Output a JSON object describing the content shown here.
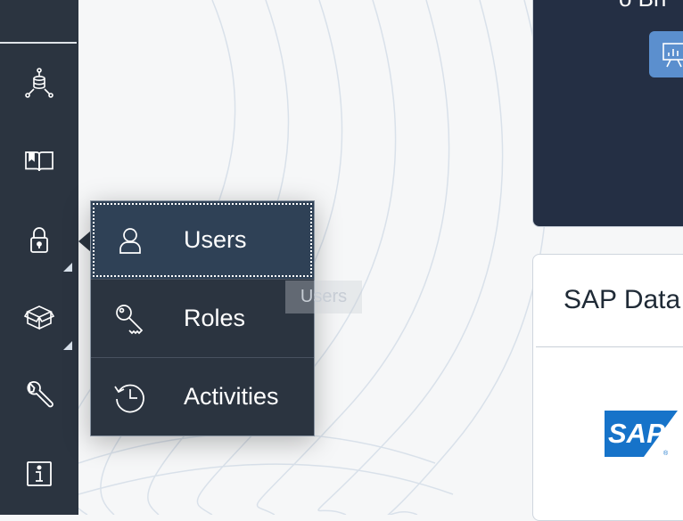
{
  "sidebar": {
    "items": [
      {
        "name": "data-network-icon",
        "has_submenu": false
      },
      {
        "name": "book-icon",
        "has_submenu": false
      },
      {
        "name": "lock-icon",
        "has_submenu": true
      },
      {
        "name": "package-icon",
        "has_submenu": true
      },
      {
        "name": "wrench-icon",
        "has_submenu": false
      },
      {
        "name": "info-icon",
        "has_submenu": false
      }
    ]
  },
  "popup_menu": {
    "items": [
      {
        "label": "Users",
        "icon": "user-icon",
        "selected": true
      },
      {
        "label": "Roles",
        "icon": "key-icon",
        "selected": false
      },
      {
        "label": "Activities",
        "icon": "history-icon",
        "selected": false
      }
    ]
  },
  "tooltip": {
    "text": "Users"
  },
  "main": {
    "top_card": {
      "title": "o  Bri"
    },
    "tile": {
      "title": "SAP Data",
      "logo_text": "SAP"
    }
  },
  "colors": {
    "sidebar_bg": "#2b3440",
    "menu_selected_bg": "#2f4156",
    "card_dark_bg": "#242f44",
    "accent_blue": "#5b8fce",
    "sap_blue": "#1673c9"
  }
}
